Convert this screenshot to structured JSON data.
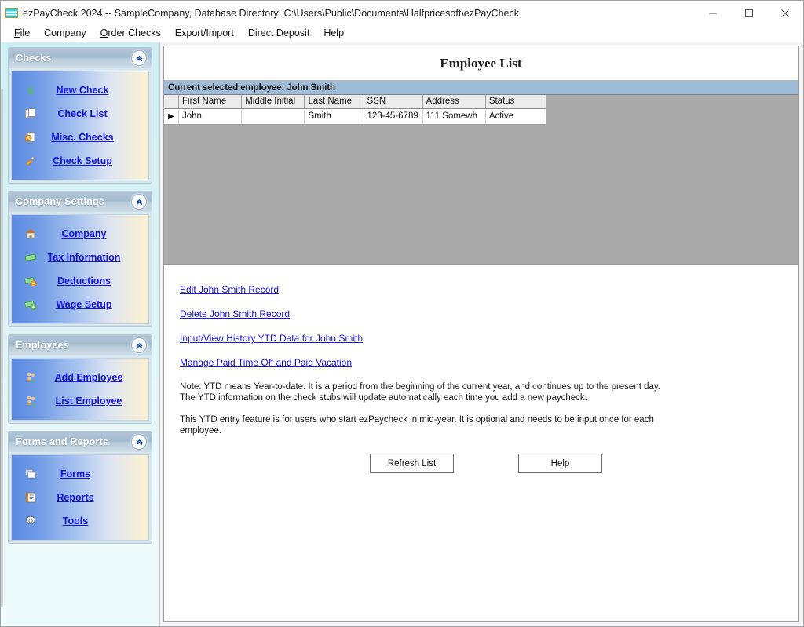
{
  "window": {
    "title": "ezPayCheck 2024 -- SampleCompany, Database Directory: C:\\Users\\Public\\Documents\\Halfpricesoft\\ezPayCheck",
    "app_icon": "check-card-icon",
    "controls": {
      "minimize": "minimize-icon",
      "maximize": "maximize-icon",
      "close": "close-icon"
    }
  },
  "menu": {
    "items": [
      {
        "label": "File",
        "accel": "F"
      },
      {
        "label": "Company",
        "accel": ""
      },
      {
        "label": "Order Checks",
        "accel": "O"
      },
      {
        "label": "Export/Import",
        "accel": ""
      },
      {
        "label": "Direct Deposit",
        "accel": ""
      },
      {
        "label": "Help",
        "accel": ""
      }
    ]
  },
  "sidebar": {
    "panels": [
      {
        "title": "Checks",
        "collapse_icon": "chevron-double-up-icon",
        "items": [
          {
            "label": "New Check",
            "icon": "dollar-icon"
          },
          {
            "label": "Check List",
            "icon": "pages-stack-icon"
          },
          {
            "label": "Misc. Checks",
            "icon": "page-coin-icon"
          },
          {
            "label": "Check Setup",
            "icon": "wrench-icon"
          }
        ]
      },
      {
        "title": "Company Settings",
        "collapse_icon": "chevron-double-up-icon",
        "items": [
          {
            "label": "Company",
            "icon": "home-icon"
          },
          {
            "label": "Tax Information",
            "icon": "money-icon"
          },
          {
            "label": "Deductions",
            "icon": "money-minus-icon"
          },
          {
            "label": "Wage Setup",
            "icon": "money-plus-icon"
          }
        ]
      },
      {
        "title": "Employees",
        "collapse_icon": "chevron-double-up-icon",
        "items": [
          {
            "label": "Add Employee",
            "icon": "people-add-icon"
          },
          {
            "label": "List Employee",
            "icon": "people-list-icon"
          }
        ]
      },
      {
        "title": "Forms and Reports",
        "collapse_icon": "chevron-double-up-icon",
        "items": [
          {
            "label": "Forms",
            "icon": "windows-forms-icon"
          },
          {
            "label": "Reports",
            "icon": "report-book-icon"
          },
          {
            "label": "Tools",
            "icon": "gear-icon"
          }
        ]
      }
    ]
  },
  "main": {
    "page_title": "Employee List",
    "selected_employee_bar": "Current selected employee:  John Smith",
    "grid": {
      "columns": [
        "First Name",
        "Middle Initial",
        "Last Name",
        "SSN",
        "Address",
        "Status"
      ],
      "rows": [
        {
          "selector": "▶",
          "cells": [
            "John",
            "",
            "Smith",
            "123-45-6789",
            "111 Somewh",
            "Active"
          ]
        }
      ]
    },
    "links": [
      "Edit John Smith Record",
      "Delete John Smith Record",
      "Input/View History YTD Data for John Smith",
      "Manage Paid Time Off and Paid Vacation"
    ],
    "notes": [
      "Note: YTD means Year-to-date. It is a period from the beginning of the current year, and continues up to the present day. The YTD information on the check stubs will update automatically each time you add a new paycheck.",
      "This YTD entry feature is for users who start ezPaycheck in mid-year. It is optional and needs to be input once for each employee."
    ],
    "buttons": [
      {
        "label": "Refresh List"
      },
      {
        "label": "Help"
      }
    ]
  },
  "colors": {
    "link": "#1414E0",
    "selected_bar": "#9FBCD8",
    "grid_backdrop": "#AAAAAA",
    "sidebar_bg": "#DDF3F5",
    "panel_header": "#A3BACD"
  }
}
